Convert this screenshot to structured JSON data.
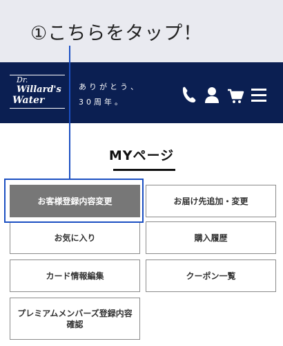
{
  "callout": {
    "text": "①こちらをタップ！"
  },
  "header": {
    "logo": {
      "line1": "Dr.",
      "line2": "Willard's",
      "line3": "Water"
    },
    "tagline": {
      "line1": "ありがとう、",
      "line2": "30周年。"
    },
    "icons": [
      "phone-icon",
      "user-icon",
      "cart-icon",
      "menu-icon"
    ],
    "background_color": "#0b1f52"
  },
  "page": {
    "title": "MYページ"
  },
  "menu": {
    "items": [
      {
        "label": "お客様登録内容変更",
        "active": true
      },
      {
        "label": "お届け先追加・変更",
        "active": false
      },
      {
        "label": "お気に入り",
        "active": false
      },
      {
        "label": "購入履歴",
        "active": false
      },
      {
        "label": "カード情報編集",
        "active": false
      },
      {
        "label": "クーポン一覧",
        "active": false
      },
      {
        "label": "プレミアムメンバーズ登録内容確認",
        "active": false
      }
    ]
  },
  "colors": {
    "highlight": "#1b4fc2",
    "active_button": "#777777"
  }
}
